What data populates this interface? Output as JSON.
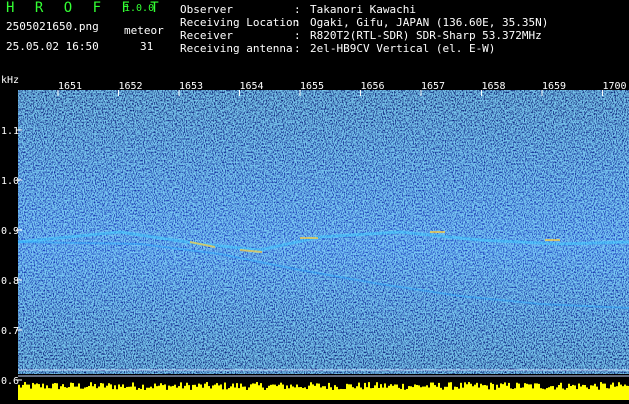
{
  "header": {
    "app_title": "H R O F F T",
    "version": "1.0.0",
    "file_name": "2505021650.png",
    "mode_label": "meteor",
    "date_time": "25.05.02 16:50",
    "count": "31",
    "info": [
      {
        "label": "Observer",
        "value": "Takanori Kawachi"
      },
      {
        "label": "Receiving Location",
        "value": "Ogaki, Gifu, JAPAN (136.60E, 35.35N)"
      },
      {
        "label": "Receiver",
        "value": "R820T2(RTL-SDR) SDR-Sharp 53.372MHz"
      },
      {
        "label": "Receiving antenna",
        "value": "2el-HB9CV Vertical (el. E-W)"
      }
    ],
    "colon": ":"
  },
  "spectrogram": {
    "y_unit": "kHz",
    "y_ticks": [
      "1.1",
      "1.0",
      "0.9",
      "0.8",
      "0.7",
      "0.6"
    ],
    "time_ticks": [
      "1651",
      "1652",
      "1653",
      "1654",
      "1655",
      "1656",
      "1657",
      "1658",
      "1659",
      "1700"
    ],
    "colors": {
      "background": "#000000",
      "noise_dark": "#0a1a6e",
      "noise_mid": "#1e3cc8",
      "signal": "#40c8ff",
      "hot": "#ffd040",
      "amplitude": "#ffff00",
      "text_green": "#33ff33",
      "axis_text": "#ffffff"
    }
  }
}
